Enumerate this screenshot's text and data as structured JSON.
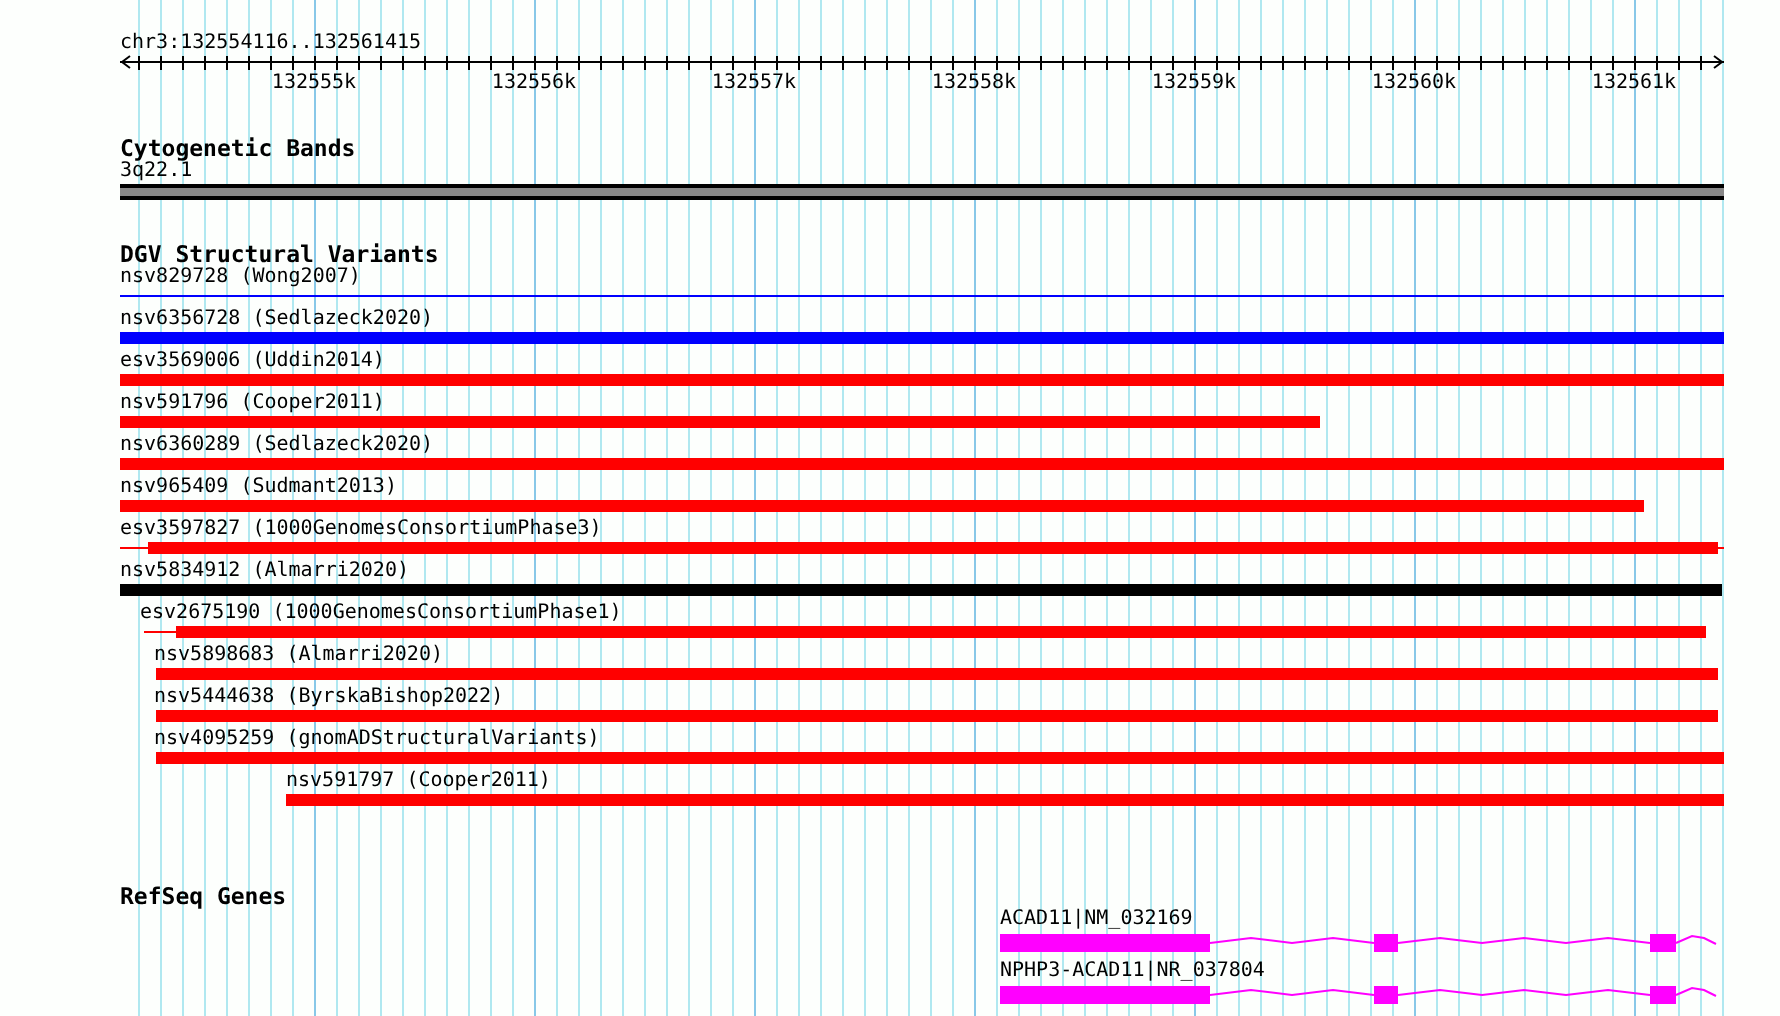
{
  "ruler": {
    "location": "chr3:132554116..132561415",
    "ticks": [
      "132555k",
      "132556k",
      "132557k",
      "132558k",
      "132559k",
      "132560k",
      "132561k"
    ]
  },
  "cytogenetic_bands": {
    "title": "Cytogenetic Bands",
    "band": "3q22.1"
  },
  "dgv_structural_variants": {
    "title": "DGV Structural Variants",
    "variants": [
      {
        "label": "nsv829728 (Wong2007)",
        "color": "#0000ff"
      },
      {
        "label": "nsv6356728 (Sedlazeck2020)",
        "color": "#0000ff"
      },
      {
        "label": "esv3569006 (Uddin2014)",
        "color": "#ff0000"
      },
      {
        "label": "nsv591796 (Cooper2011)",
        "color": "#ff0000"
      },
      {
        "label": "nsv6360289 (Sedlazeck2020)",
        "color": "#ff0000"
      },
      {
        "label": "nsv965409 (Sudmant2013)",
        "color": "#ff0000"
      },
      {
        "label": "esv3597827 (1000GenomesConsortiumPhase3)",
        "color": "#ff0000"
      },
      {
        "label": "nsv5834912 (Almarri2020)",
        "color": "#000000"
      },
      {
        "label": "esv2675190 (1000GenomesConsortiumPhase1)",
        "color": "#ff0000"
      },
      {
        "label": "nsv5898683 (Almarri2020)",
        "color": "#ff0000"
      },
      {
        "label": "nsv5444638 (ByrskaBishop2022)",
        "color": "#ff0000"
      },
      {
        "label": "nsv4095259 (gnomADStructuralVariants)",
        "color": "#ff0000"
      },
      {
        "label": "nsv591797 (Cooper2011)",
        "color": "#ff0000"
      }
    ]
  },
  "refseq_genes": {
    "title": "RefSeq Genes",
    "genes": [
      {
        "label": "ACAD11|NM_032169"
      },
      {
        "label": "NPHP3-ACAD11|NR_037804"
      }
    ]
  }
}
